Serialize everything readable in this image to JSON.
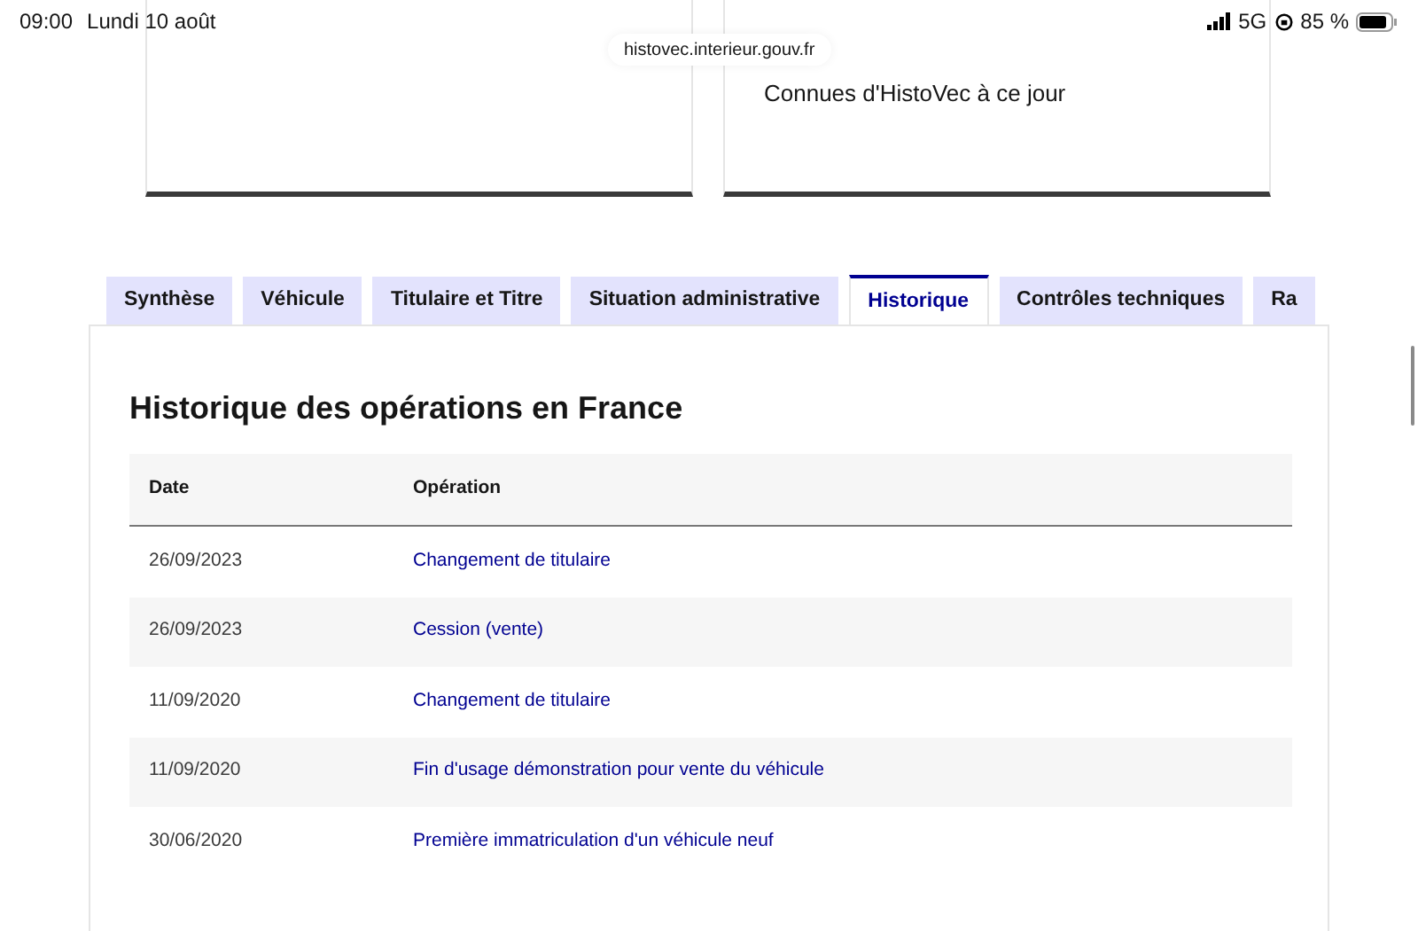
{
  "status_bar": {
    "time": "09:00",
    "date": "Lundi 10 août",
    "network": "5G",
    "battery": "85 %"
  },
  "url": "histovec.interieur.gouv.fr",
  "cards": [
    {
      "kind": "blank"
    },
    {
      "kind": "text",
      "text": "Connues d'HistoVec à ce jour"
    }
  ],
  "tabs": [
    {
      "label": "Synthèse",
      "selected": false
    },
    {
      "label": "Véhicule",
      "selected": false
    },
    {
      "label": "Titulaire et Titre",
      "selected": false
    },
    {
      "label": "Situation administrative",
      "selected": false
    },
    {
      "label": "Historique",
      "selected": true
    },
    {
      "label": "Contrôles techniques",
      "selected": false
    },
    {
      "label": "Ra",
      "selected": false
    }
  ],
  "panel": {
    "title": "Historique des opérations en France",
    "table": {
      "columns": [
        "Date",
        "Opération"
      ],
      "rows": [
        {
          "date": "26/09/2023",
          "operation": "Changement de titulaire"
        },
        {
          "date": "26/09/2023",
          "operation": "Cession (vente)"
        },
        {
          "date": "11/09/2020",
          "operation": "Changement de titulaire"
        },
        {
          "date": "11/09/2020",
          "operation": "Fin d'usage démonstration pour vente du véhicule"
        },
        {
          "date": "30/06/2020",
          "operation": "Première immatriculation d'un véhicule neuf"
        }
      ]
    }
  }
}
